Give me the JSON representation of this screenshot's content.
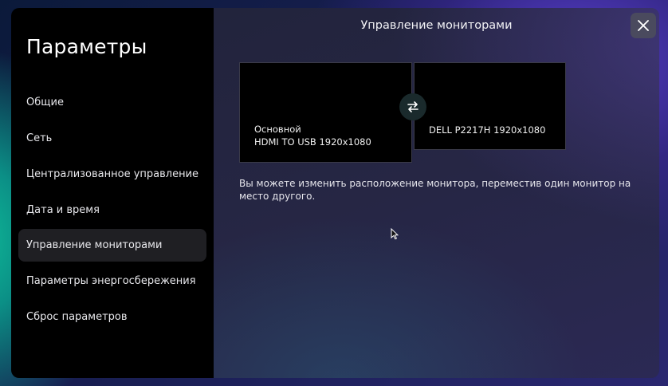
{
  "sidebar": {
    "title": "Параметры",
    "items": [
      {
        "label": "Общие"
      },
      {
        "label": "Сеть"
      },
      {
        "label": "Централизованное управление"
      },
      {
        "label": "Дата и время"
      },
      {
        "label": "Управление мониторами",
        "active": true
      },
      {
        "label": "Параметры энергосбережения"
      },
      {
        "label": "Сброс параметров"
      }
    ]
  },
  "main": {
    "title": "Управление мониторами",
    "close_icon": "close-icon",
    "swap_icon": "swap-arrows-icon",
    "monitors": [
      {
        "role": "Основной",
        "name": "HDMI TO USB 1920x1080"
      },
      {
        "role": "",
        "name": "DELL P2217H 1920x1080"
      }
    ],
    "hint": "Вы можете изменить расположение монитора, переместив один монитор на место другого."
  },
  "colors": {
    "sidebar_bg": "#000000",
    "active_item_bg": "#1f1f23",
    "close_btn_bg": "#4a4a5e",
    "swap_btn_bg": "#1a2a2c"
  }
}
